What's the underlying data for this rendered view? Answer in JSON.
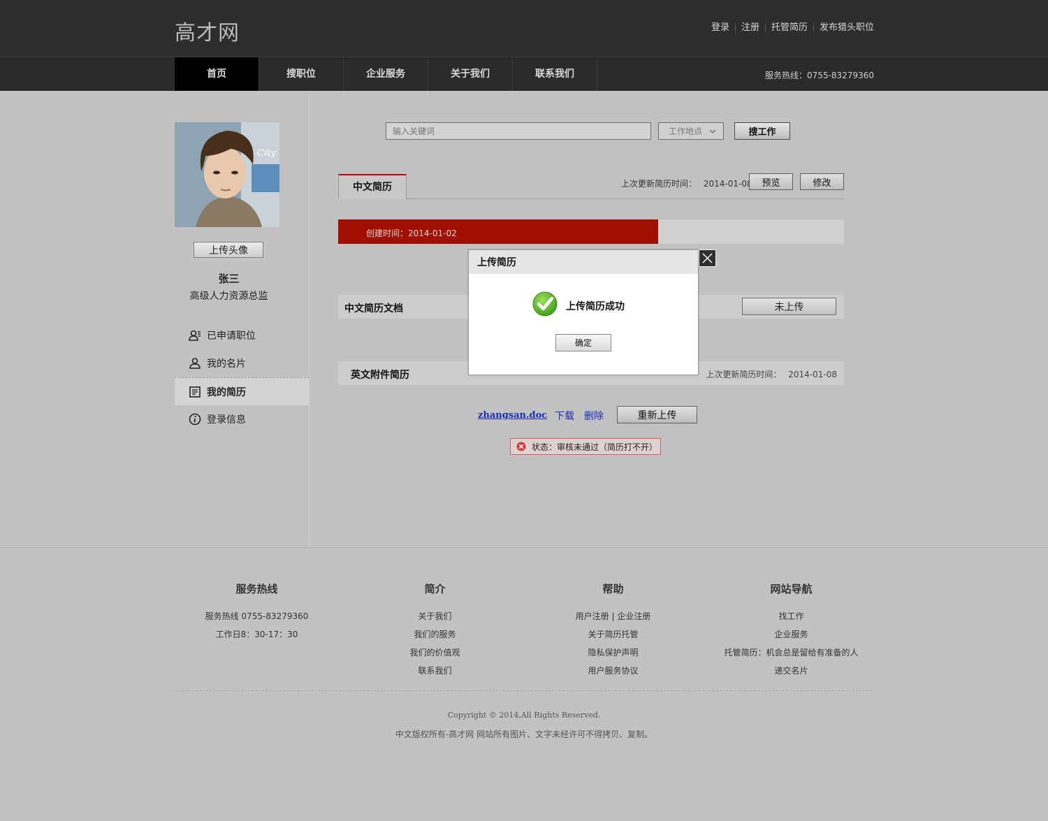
{
  "header": {
    "logo": "高才网",
    "links": [
      "登录",
      "注册",
      "托管简历",
      "发布猎头职位"
    ]
  },
  "nav": {
    "items": [
      "首页",
      "搜职位",
      "企业服务",
      "关于我们",
      "联系我们"
    ],
    "active_index": 0,
    "hotline": "服务热线：0755-83279360"
  },
  "sidebar": {
    "upload_avatar": "上传头像",
    "name": "张三",
    "title": "高级人力资源总监",
    "menu": [
      {
        "label": "已申请职位",
        "icon": "applied-jobs-icon"
      },
      {
        "label": "我的名片",
        "icon": "user-card-icon"
      },
      {
        "label": "我的简历",
        "icon": "resume-icon"
      },
      {
        "label": "登录信息",
        "icon": "info-icon"
      }
    ],
    "active_index": 2
  },
  "search": {
    "placeholder": "输入关键词",
    "location": "工作地点",
    "button": "搜工作"
  },
  "resume": {
    "tab": "中文简历",
    "last_update_label": "上次更新简历时间：",
    "last_update_date": "2014-01-08",
    "preview": "预览",
    "edit": "修改",
    "created_label": "创建时间：2014-01-02",
    "progress_fraction": 0.633,
    "cn_doc_title": "中文简历文档",
    "not_uploaded": "未上传",
    "en_title": "英文附件简历",
    "en_update_label": "上次更新简历时间：",
    "en_update_date": "2014-01-08",
    "file_name": "zhangsan.doc",
    "download": "下载",
    "delete": "删除",
    "reupload": "重新上传",
    "status": "状态：审核未通过（简历打不开）"
  },
  "modal": {
    "title": "上传简历",
    "message": "上传简历成功",
    "ok": "确定"
  },
  "footer": {
    "columns": [
      {
        "title": "服务热线",
        "items": [
          "服务热线 0755-83279360",
          "工作日8：30-17：30"
        ]
      },
      {
        "title": "简介",
        "items": [
          "关于我们",
          "我们的服务",
          "我们的价值观",
          "联系我们"
        ]
      },
      {
        "title": "帮助",
        "items": [
          "用户注册 | 企业注册",
          "关于简历托管",
          "隐私保护声明",
          "用户服务协议"
        ]
      },
      {
        "title": "网站导航",
        "items": [
          "找工作",
          "企业服务",
          "托管简历：机会总是留给有准备的人",
          "递交名片"
        ]
      }
    ],
    "copyright": "Copyright © 2014,All Rights Reserved.",
    "notice": "中文版权所有-高才网 网站所有图片、文字未经许可不得拷贝、复制。"
  },
  "colors": {
    "header_bg": "#2c2d2f",
    "accent_red": "#a01000",
    "link_blue": "#1a2db5",
    "page_bg": "#c2c2c2"
  }
}
